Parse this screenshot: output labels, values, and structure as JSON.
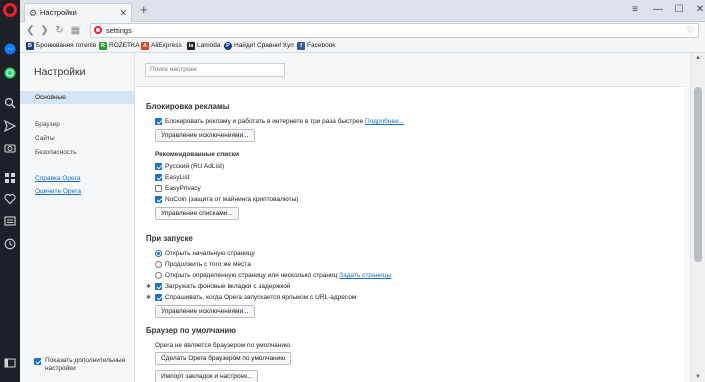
{
  "window": {
    "tab_title": "Настройки",
    "tab_close": "✕",
    "new_tab": "+",
    "minimize": "—",
    "maximize": "☐",
    "close": "✕",
    "menu": "≡"
  },
  "address": {
    "url": "settings"
  },
  "bookmarks": [
    {
      "label": "Бронювання готелів",
      "icon": "booking-icon",
      "color": "#1f3c8a",
      "glyph": "B"
    },
    {
      "label": "ROZETKA",
      "icon": "rozetka-icon",
      "color": "#2e9c3a",
      "glyph": "R"
    },
    {
      "label": "AliExpress",
      "icon": "aliexpress-icon",
      "color": "#e5432a",
      "glyph": "A"
    },
    {
      "label": "Lamoda",
      "icon": "lamoda-icon",
      "color": "#222222",
      "glyph": "la"
    },
    {
      "label": "Найди! Сравни! Куп",
      "icon": "price-compare-icon",
      "color": "#1e3a8c",
      "glyph": "P"
    },
    {
      "label": "Facebook",
      "icon": "facebook-icon",
      "color": "#3b5998",
      "glyph": "f"
    }
  ],
  "sidebar": {
    "title": "Настройки",
    "items": [
      {
        "label": "Основные",
        "active": true
      },
      {
        "label": "Браузер"
      },
      {
        "label": "Сайты"
      },
      {
        "label": "Безопасность"
      }
    ],
    "links": [
      "Справка Opera",
      "Оцените Opera"
    ],
    "footer_checkbox": "Показать дополнительные настройки"
  },
  "search": {
    "placeholder": "Поиск настроек"
  },
  "adblock": {
    "title": "Блокировка рекламы",
    "enable": "Блокировать рекламу и работать в интернете в три раза быстрее",
    "more": "Подробнее...",
    "exceptions_btn": "Управление исключениями...",
    "lists_title": "Рекомендованные списки",
    "lists": [
      {
        "label": "Русский (RU AdList)",
        "checked": true
      },
      {
        "label": "EasyList",
        "checked": true
      },
      {
        "label": "EasyPrivacy",
        "checked": false
      },
      {
        "label": "NoCoin (защита от майнинга криптовалюты)",
        "checked": true
      }
    ],
    "lists_btn": "Управление списками..."
  },
  "startup": {
    "title": "При запуске",
    "options": [
      {
        "label": "Открыть начальную страницу",
        "selected": true
      },
      {
        "label": "Продолжить с того же места",
        "selected": false
      },
      {
        "label": "Открыть определенную страницу или несколько страниц",
        "selected": false,
        "link": "Задать страницы"
      }
    ],
    "checks": [
      {
        "label": "Загружать фоновые вкладки с задержкой",
        "checked": true
      },
      {
        "label": "Спрашивать, когда Opera запускается ярлыком с URL-адресом",
        "checked": true
      }
    ],
    "star": "✱",
    "exceptions_btn": "Управление исключениями..."
  },
  "default_browser": {
    "title": "Браузер по умолчанию",
    "status": "Opera не является браузером по умолчанию.",
    "make_default_btn": "Сделать Opera браузером по умолчанию",
    "import_btn": "Импорт закладок и настроек..."
  },
  "colors": {
    "accent": "#1e6fc9",
    "opera_red": "#ff1b2d",
    "sidebar_dark": "#1b2126"
  }
}
